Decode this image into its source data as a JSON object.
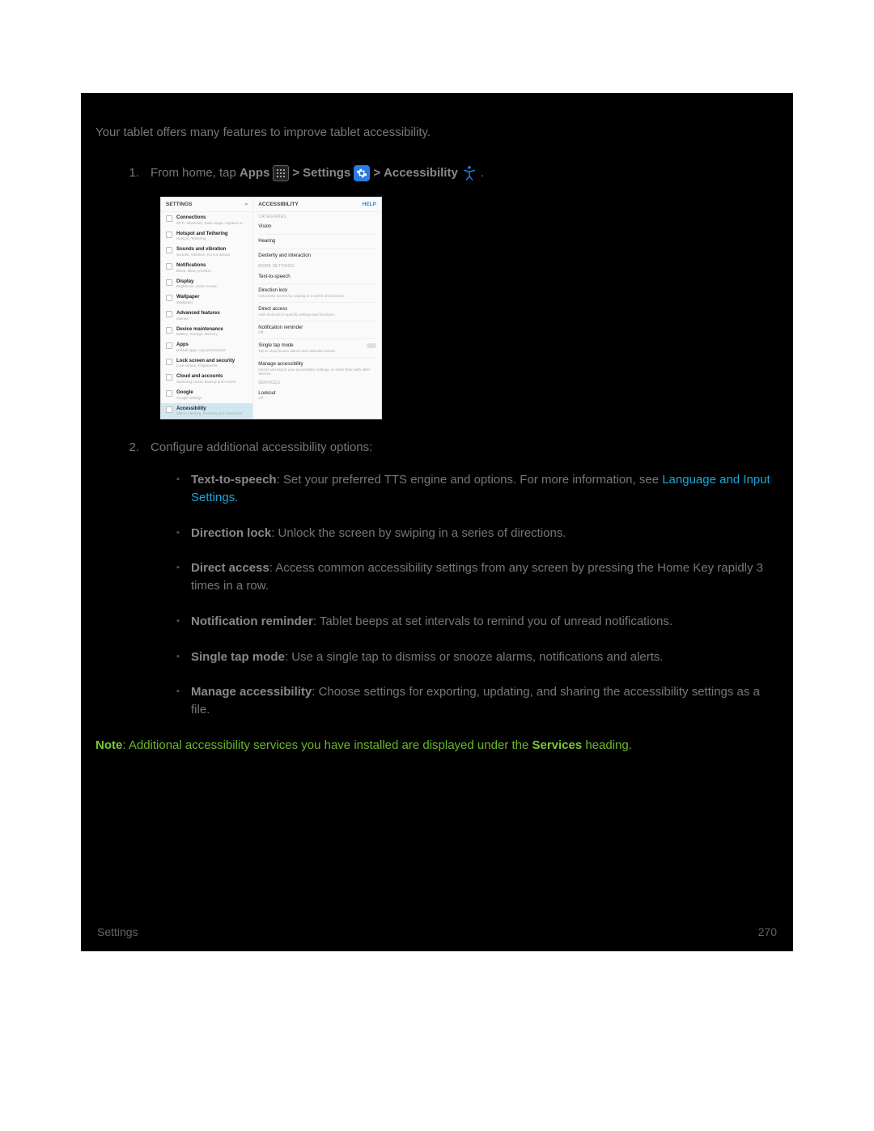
{
  "intro": "Your tablet offers many features to improve tablet accessibility.",
  "step1": {
    "num": "1.",
    "pre": "From home, tap ",
    "apps": "Apps",
    "sep1": " > ",
    "settings": "Settings",
    "sep2": " > ",
    "accessibility": "Accessibility",
    "end": "."
  },
  "screenshot": {
    "left": {
      "header": "SETTINGS",
      "search_glyph": "⌕",
      "items": [
        {
          "t": "Connections",
          "s": "Wi-Fi, Bluetooth, Data usage, Airplane m..."
        },
        {
          "t": "Hotspot and Tethering",
          "s": "Hotspot, Tethering"
        },
        {
          "t": "Sounds and vibration",
          "s": "Sounds, Vibration, Do not disturb"
        },
        {
          "t": "Notifications",
          "s": "Block, allow, prioritize"
        },
        {
          "t": "Display",
          "s": "Brightness, Home screen"
        },
        {
          "t": "Wallpaper",
          "s": "Wallpaper"
        },
        {
          "t": "Advanced features",
          "s": "Games"
        },
        {
          "t": "Device maintenance",
          "s": "Battery, Storage, Memory"
        },
        {
          "t": "Apps",
          "s": "Default apps, App permissions"
        },
        {
          "t": "Lock screen and security",
          "s": "Lock screen, Fingerprints"
        },
        {
          "t": "Cloud and accounts",
          "s": "Samsung Cloud, Backup and restore"
        },
        {
          "t": "Google",
          "s": "Google settings"
        },
        {
          "t": "Accessibility",
          "s": "Vision, Hearing, Dexterity and interaction",
          "sel": true
        }
      ]
    },
    "right": {
      "header": "ACCESSIBILITY",
      "help": "HELP",
      "sec1": "CATEGORIES",
      "cat": [
        "Vision",
        "Hearing",
        "Dexterity and interaction"
      ],
      "sec2": "MORE SETTINGS",
      "more": [
        {
          "t": "Text-to-speech",
          "s": ""
        },
        {
          "t": "Direction lock",
          "s": "Unlock the screen by swiping in a series of directions."
        },
        {
          "t": "Direct access",
          "s": "Add shortcuts to specific settings and functions."
        },
        {
          "t": "Notification reminder",
          "s": "Off"
        },
        {
          "t": "Single tap mode",
          "s": "Tap to stop/snooze alarms and calendar events.",
          "toggle": true
        },
        {
          "t": "Manage accessibility",
          "s": "Import and export your accessibility settings, or share them with other devices."
        }
      ],
      "sec3": "SERVICES",
      "svc": [
        {
          "t": "Lookout",
          "s": "Off"
        }
      ]
    }
  },
  "step2": {
    "num": "2.",
    "text": "Configure additional accessibility options:"
  },
  "bullets": [
    {
      "b": "Text-to-speech",
      "t": ": Set your preferred TTS engine and options. For more information, see ",
      "link": "Language and Input Settings",
      "after": "."
    },
    {
      "b": "Direction lock",
      "t": ": Unlock the screen by swiping in a series of directions."
    },
    {
      "b": "Direct access",
      "t": ": Access common accessibility settings from any screen by pressing the Home Key rapidly 3 times in a row."
    },
    {
      "b": "Notification reminder",
      "t": ": Tablet beeps at set intervals to remind you of unread notifications."
    },
    {
      "b": "Single tap mode",
      "t": ": Use a single tap to dismiss or snooze alarms, notifications and alerts."
    },
    {
      "b": "Manage accessibility",
      "t": ": Choose settings for exporting, updating, and sharing the accessibility settings as a file."
    }
  ],
  "note": {
    "label": "Note",
    "t1": ": Additional accessibility services you have installed are displayed under the ",
    "services": "Services",
    "t2": " heading."
  },
  "footer": {
    "left": "Settings",
    "right": "270"
  }
}
